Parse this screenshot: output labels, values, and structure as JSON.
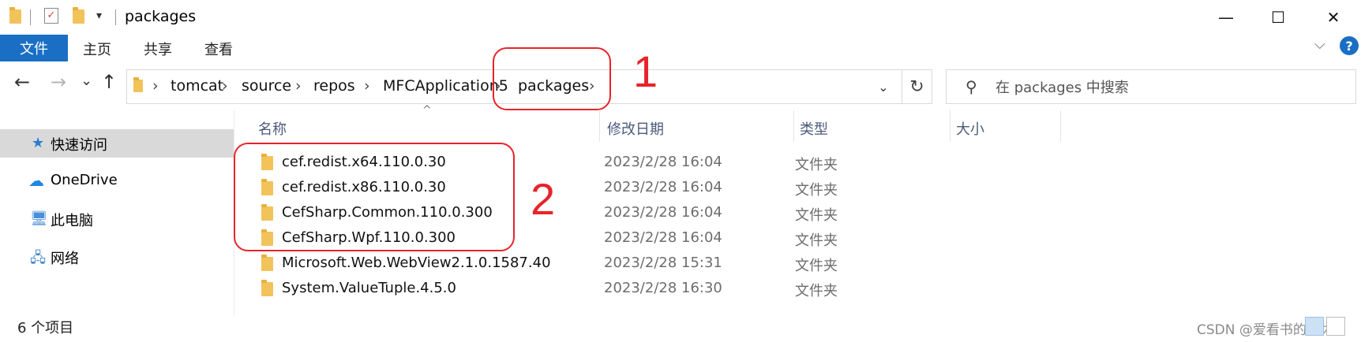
{
  "window": {
    "title": "packages",
    "minimize_glyph": "—",
    "maximize_glyph": "☐",
    "close_glyph": "✕",
    "quick_access_glyph": "▾"
  },
  "ribbon": {
    "file_tab": "文件",
    "tabs": [
      "主页",
      "共享",
      "查看"
    ],
    "collapse_glyph": "⌵",
    "help_glyph": "?"
  },
  "nav": {
    "back_glyph": "←",
    "forward_glyph": "→",
    "recent_glyph": "⌄",
    "up_glyph": "↑",
    "breadcrumb": [
      "tomcat",
      "source",
      "repos",
      "MFCApplication5",
      "packages"
    ],
    "crumb_separator": "›",
    "dropdown_glyph": "⌄",
    "refresh_glyph": "↻"
  },
  "search": {
    "placeholder": "在 packages 中搜索",
    "icon_glyph": "⚲"
  },
  "sidebar": {
    "items": [
      {
        "label": "快速访问",
        "icon": "star-icon",
        "glyph": "★",
        "color": "#2b7cd3",
        "selected": true
      },
      {
        "label": "OneDrive",
        "icon": "cloud-icon",
        "glyph": "☁",
        "color": "#1e88e5",
        "selected": false
      },
      {
        "label": "此电脑",
        "icon": "computer-icon",
        "glyph": "🖥",
        "color": "#4a90d9",
        "selected": false
      },
      {
        "label": "网络",
        "icon": "network-icon",
        "glyph": "🖧",
        "color": "#3b82c4",
        "selected": false
      }
    ]
  },
  "columns": {
    "name": "名称",
    "modified": "修改日期",
    "type": "类型",
    "size": "大小",
    "sort_glyph": "^"
  },
  "files": [
    {
      "name": "cef.redist.x64.110.0.30",
      "modified": "2023/2/28 16:04",
      "type": "文件夹"
    },
    {
      "name": "cef.redist.x86.110.0.30",
      "modified": "2023/2/28 16:04",
      "type": "文件夹"
    },
    {
      "name": "CefSharp.Common.110.0.300",
      "modified": "2023/2/28 16:04",
      "type": "文件夹"
    },
    {
      "name": "CefSharp.Wpf.110.0.300",
      "modified": "2023/2/28 16:04",
      "type": "文件夹"
    },
    {
      "name": "Microsoft.Web.WebView2.1.0.1587.40",
      "modified": "2023/2/28 15:31",
      "type": "文件夹"
    },
    {
      "name": "System.ValueTuple.4.5.0",
      "modified": "2023/2/28 16:30",
      "type": "文件夹"
    }
  ],
  "status": {
    "item_count": "6 个项目"
  },
  "watermark": "CSDN @爱看书的小沐",
  "annotations": {
    "label_1": "1",
    "label_2": "2",
    "color": "#e8232b"
  },
  "colors": {
    "accent": "#1a6fc4",
    "folder": "#f2c35b",
    "selection": "#d9d9d9"
  }
}
